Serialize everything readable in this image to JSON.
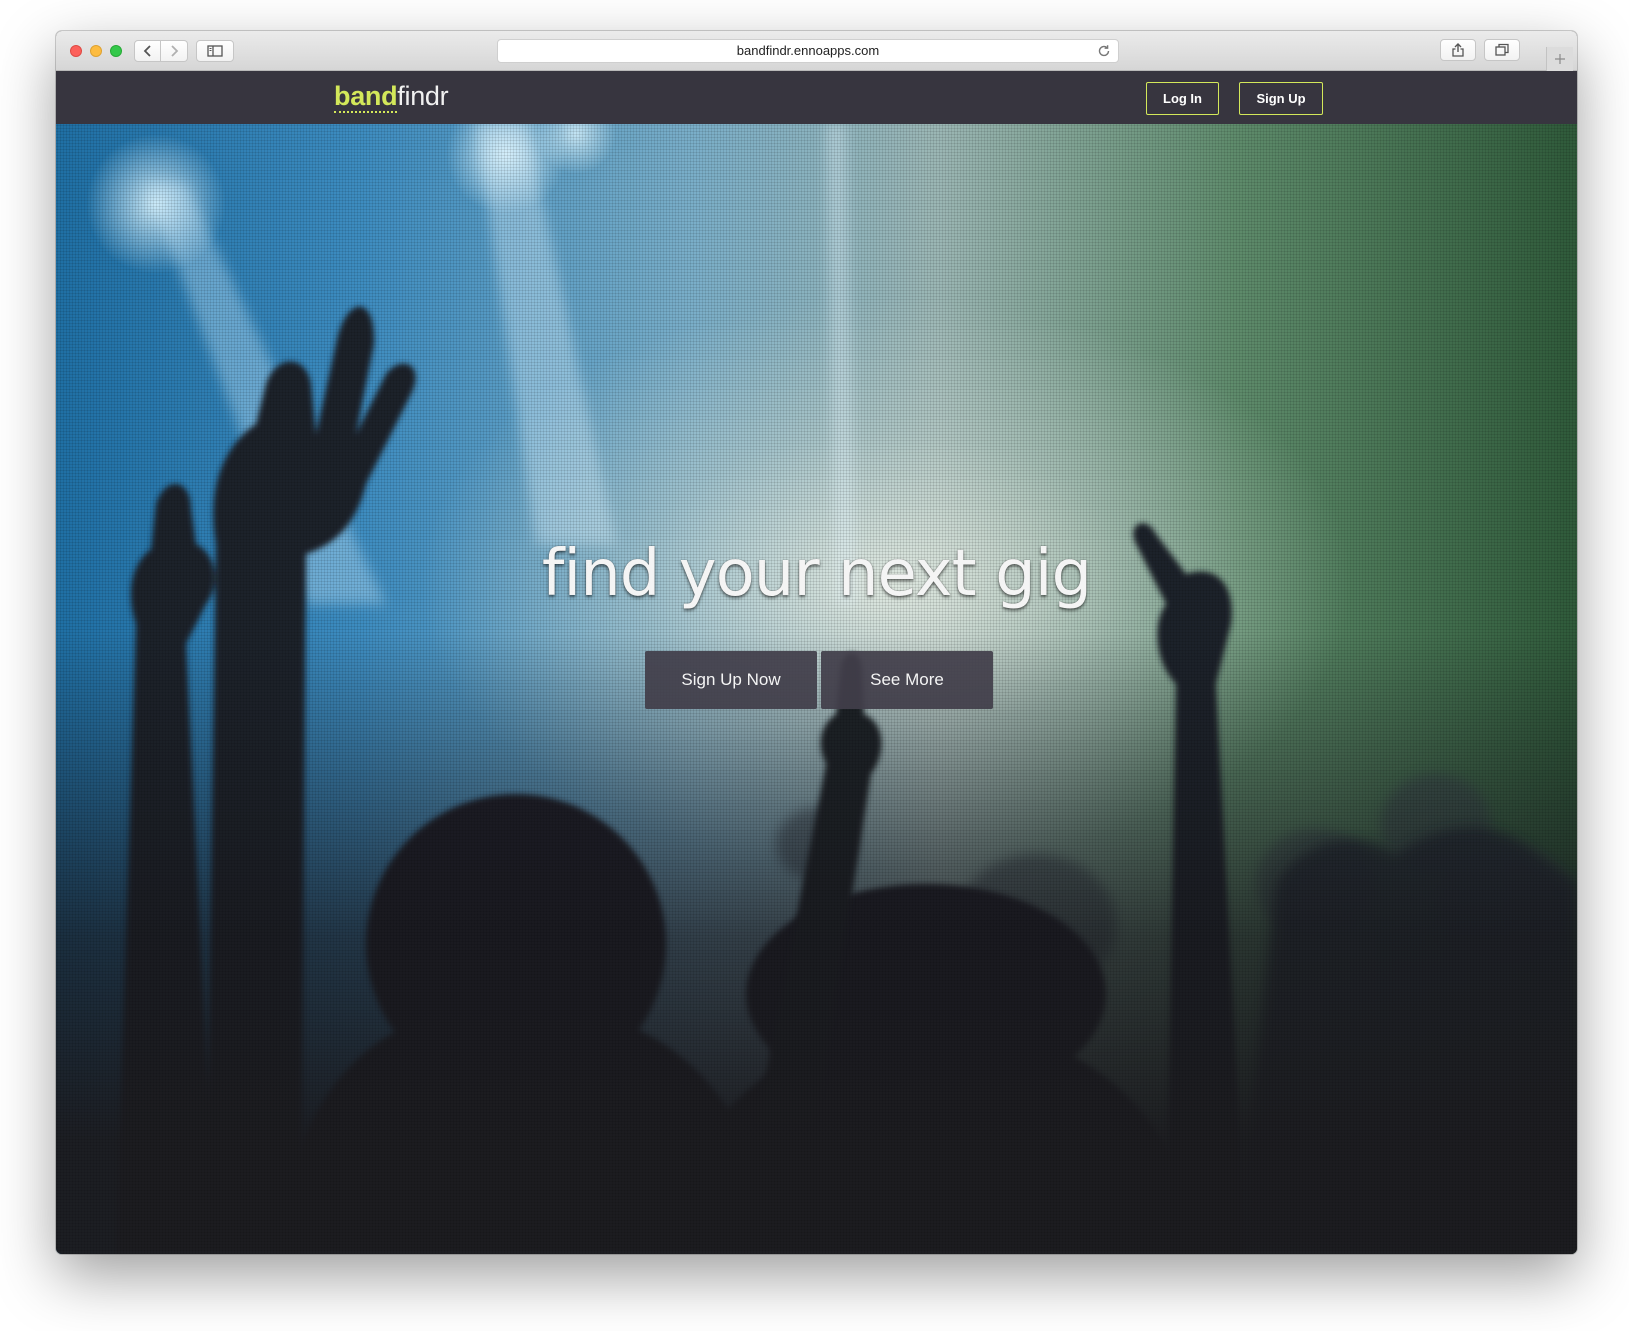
{
  "browser": {
    "url": "bandfindr.ennoapps.com",
    "icons": {
      "back": "chevron-left-icon",
      "forward": "chevron-right-icon",
      "sidebar": "sidebar-icon",
      "reload": "reload-icon",
      "share": "share-icon",
      "tabs": "tabs-overview-icon",
      "new_tab": "plus-icon"
    }
  },
  "site": {
    "logo": {
      "part1": "band",
      "part2": "findr"
    },
    "nav": {
      "login_label": "Log In",
      "signup_label": "Sign Up"
    },
    "hero": {
      "title": "find your next gig",
      "primary_cta": "Sign Up Now",
      "secondary_cta": "See More"
    }
  },
  "colors": {
    "accent": "#d3e85a",
    "nav_bg": "#37353f",
    "button_bg": "#423e4a",
    "text_light": "#f4f4f4"
  }
}
